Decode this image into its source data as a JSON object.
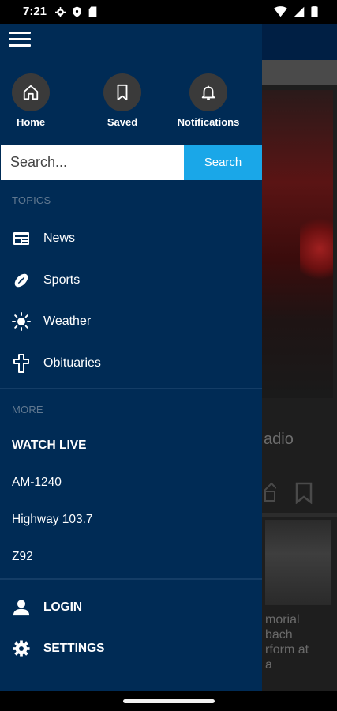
{
  "status_bar": {
    "time": "7:21",
    "left_icons": [
      "gear-icon",
      "shield-icon",
      "sd-card-icon"
    ],
    "right_icons": [
      "wifi-icon",
      "signal-icon",
      "battery-icon"
    ]
  },
  "quick_actions": [
    {
      "label": "Home",
      "icon": "home-icon"
    },
    {
      "label": "Saved",
      "icon": "bookmark-icon"
    },
    {
      "label": "Notifications",
      "icon": "bell-icon"
    }
  ],
  "search": {
    "placeholder": "Search...",
    "button_label": "Search"
  },
  "topics": {
    "heading": "TOPICS",
    "items": [
      {
        "label": "News",
        "icon": "newspaper-icon"
      },
      {
        "label": "Sports",
        "icon": "football-icon"
      },
      {
        "label": "Weather",
        "icon": "sun-icon"
      },
      {
        "label": "Obituaries",
        "icon": "cross-icon"
      }
    ]
  },
  "more": {
    "heading": "MORE",
    "items": [
      "WATCH LIVE",
      "AM-1240",
      "Highway 103.7",
      "Z92"
    ]
  },
  "account": {
    "items": [
      {
        "label": "LOGIN",
        "icon": "person-icon"
      },
      {
        "label": "SETTINGS",
        "icon": "gear-icon"
      }
    ]
  },
  "background_content": {
    "card_title_fragment": "adio",
    "card2_text_lines": [
      "morial",
      "bach",
      "rform at",
      "a"
    ]
  },
  "colors": {
    "drawer_bg": "#002b55",
    "search_button": "#1aa7e8",
    "section_heading": "#607890"
  }
}
